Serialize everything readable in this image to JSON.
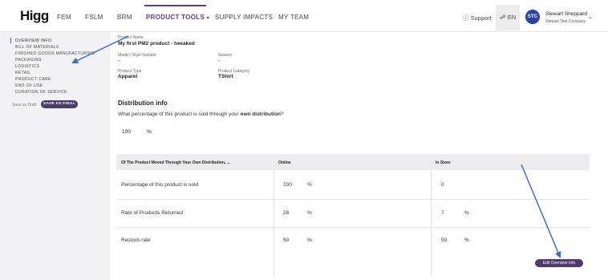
{
  "header": {
    "logo": "Higg",
    "nav": [
      "FEM",
      "FSLM",
      "BRM",
      "PRODUCT TOOLS",
      "SUPPLY IMPACTS",
      "MY TEAM"
    ],
    "support": "Support",
    "language": "EN",
    "avatar": "STC",
    "user_name": "Stewart Sheppard",
    "user_company": "Stewart Test Company"
  },
  "sidebar": {
    "items": [
      "OVERVIEW INFO",
      "BILL OF MATERIALS",
      "FINISHED GOODS MANUFACTURING",
      "PACKAGING",
      "LOGISTICS",
      "RETAIL",
      "PRODUCT CARE",
      "END OF USE",
      "DURATION OF SERVICE"
    ],
    "save_draft": "Save as Draft",
    "save_final": "SAVE AS FINAL"
  },
  "product": {
    "name_label": "Product Name",
    "name": "My first PM2 product - tweaked",
    "model_label": "Model / Style Number",
    "model": "-",
    "season_label": "Season",
    "season": "-",
    "type_label": "Product Type",
    "type": "Apparel",
    "category_label": "Product Category",
    "category": "TShirt"
  },
  "distribution": {
    "title": "Distribution info",
    "question_pre": "What percentage of this product is sold through your ",
    "question_bold": "own distribution",
    "question_post": "?",
    "value": "100",
    "unit": "%",
    "table": {
      "headers": [
        "Of The Product Moved Through Your Own Distribution, ...",
        "Online",
        "In Store"
      ],
      "rows": [
        {
          "label": "Percentage of this product is sold",
          "online": "100",
          "online_unit": "%",
          "store": "0",
          "store_unit": ""
        },
        {
          "label": "Rate of Products Returned",
          "online": "28",
          "online_unit": "%",
          "store": "7",
          "store_unit": "%"
        },
        {
          "label": "Restock rate",
          "online": "50",
          "online_unit": "%",
          "store": "50",
          "store_unit": "%"
        }
      ]
    }
  },
  "actions": {
    "edit": "Edit Overview Info"
  },
  "colors": {
    "accent": "#5a3d8a",
    "button": "#4e3b6e",
    "annotation_arrow": "#3a6fc9",
    "avatar": "#2a3fa8"
  }
}
